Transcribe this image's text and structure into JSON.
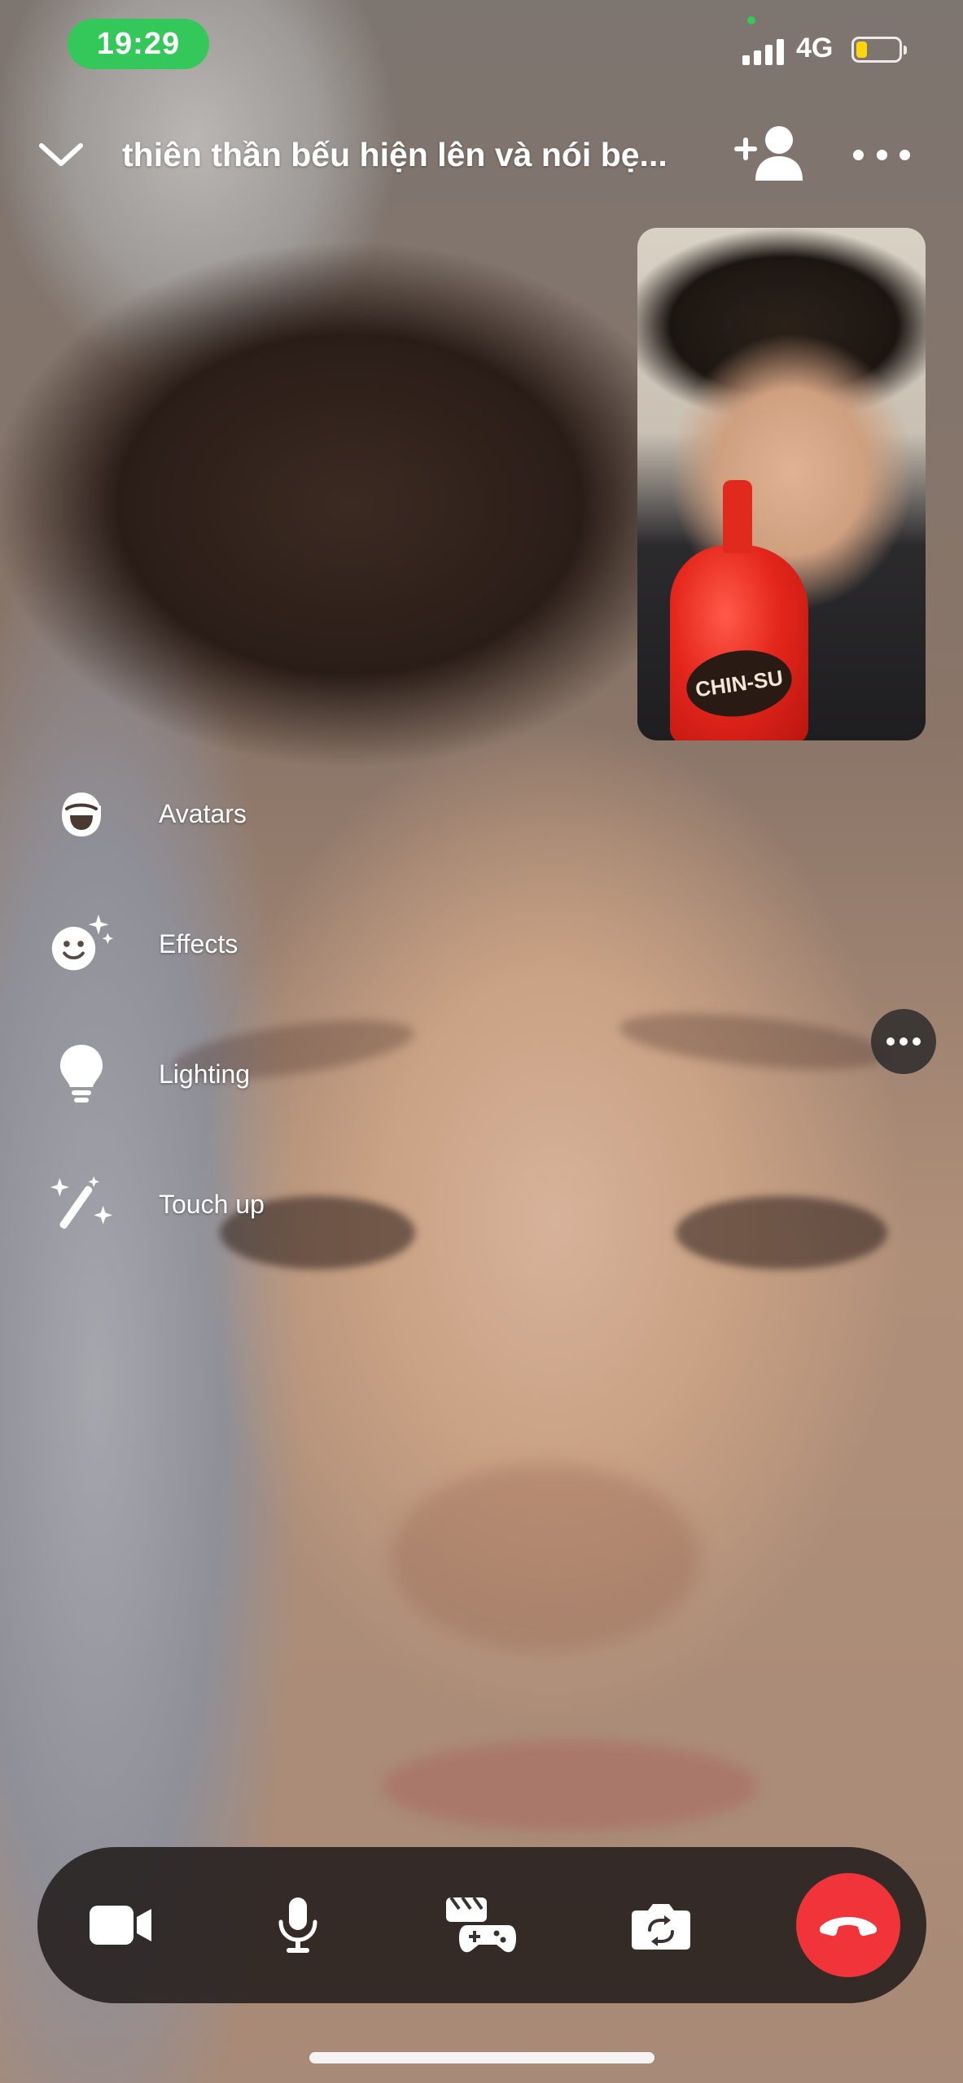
{
  "status_bar": {
    "time": "19:29",
    "network": "4G",
    "signal_bars": 4,
    "battery_level": 0.25,
    "battery_color": "#ffd60a",
    "time_pill_color": "#34c759"
  },
  "header": {
    "title": "thiên thần bếu hiện lên và nói bẹ...",
    "icons": [
      "chevron-down-icon",
      "add-person-icon",
      "more-horizontal-icon"
    ]
  },
  "self_view": {
    "bottle_label": "CHIN-SU"
  },
  "side_menu": {
    "items": [
      {
        "label": "Avatars",
        "icon": "avatar-icon"
      },
      {
        "label": "Effects",
        "icon": "effects-smiley-icon"
      },
      {
        "label": "Lighting",
        "icon": "lightbulb-icon"
      },
      {
        "label": "Touch up",
        "icon": "magic-wand-icon"
      }
    ]
  },
  "controls": {
    "items": [
      {
        "icon": "video-camera-icon"
      },
      {
        "icon": "microphone-icon"
      },
      {
        "icon": "games-icon"
      },
      {
        "icon": "flip-camera-icon"
      },
      {
        "icon": "end-call-icon"
      }
    ],
    "end_call_color": "#f0343a"
  }
}
